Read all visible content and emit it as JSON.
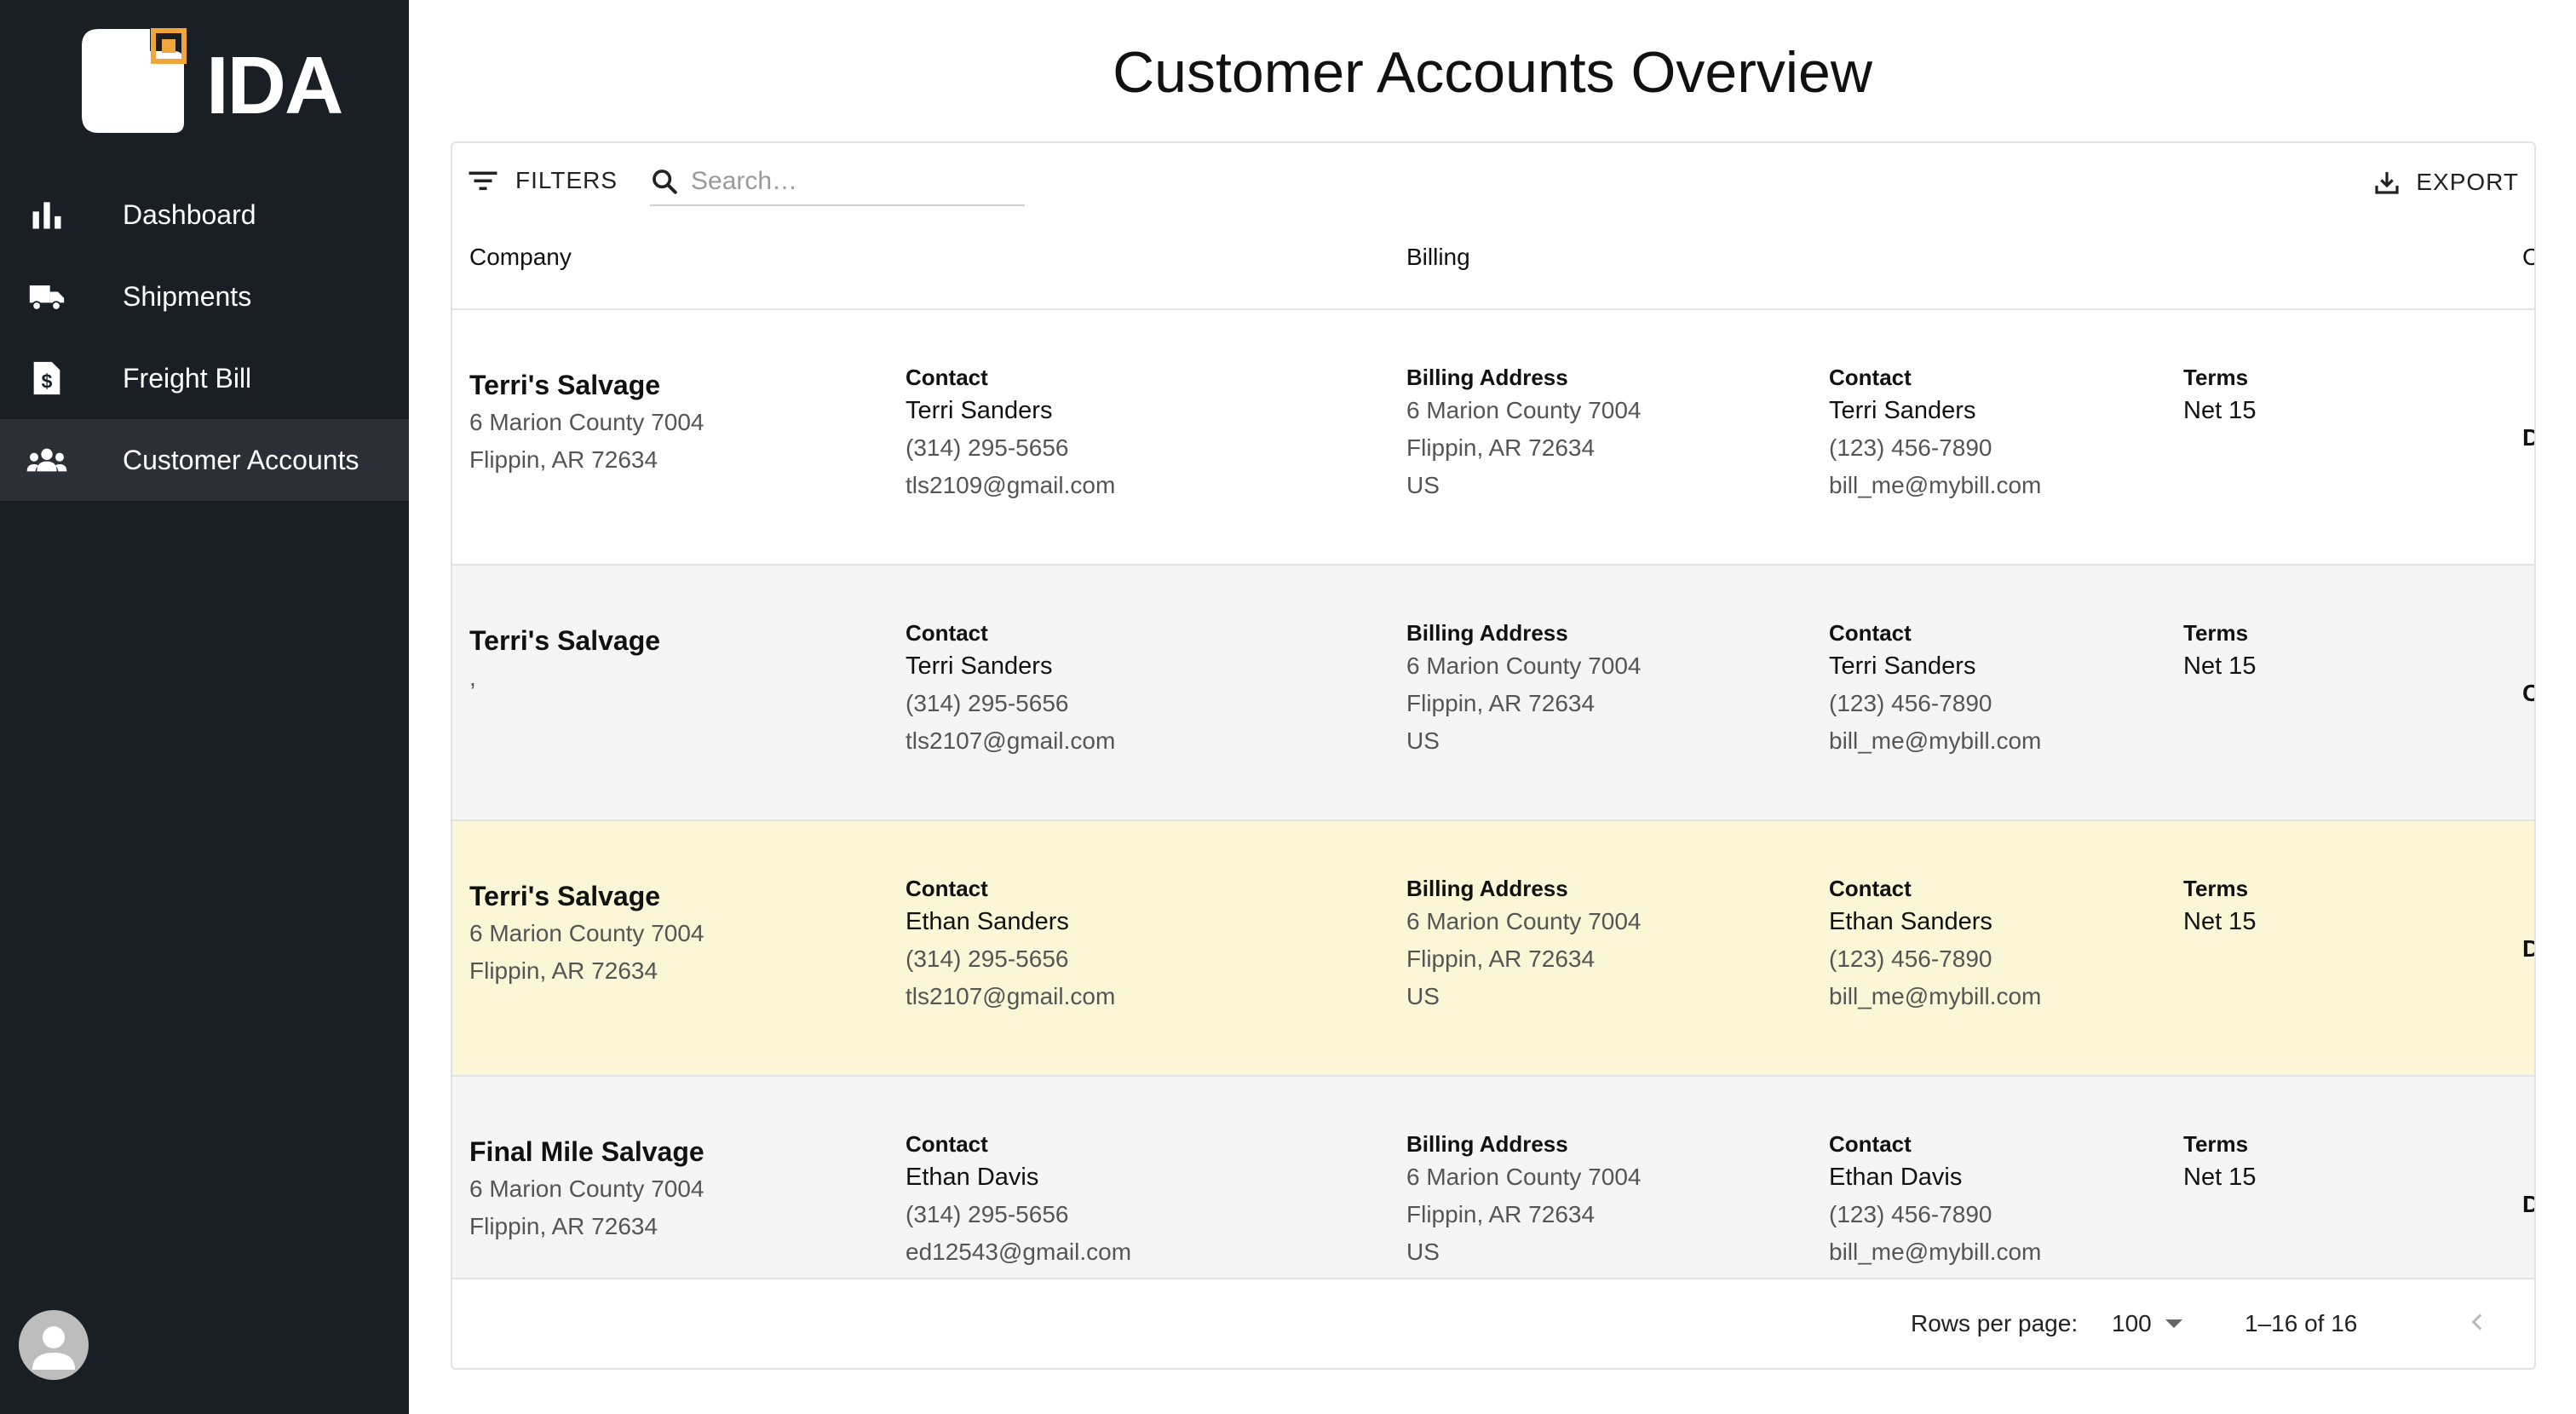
{
  "app": {
    "logo_text": "IDA"
  },
  "sidebar": {
    "items": [
      {
        "label": "Dashboard",
        "icon": "bar-chart-icon"
      },
      {
        "label": "Shipments",
        "icon": "truck-icon"
      },
      {
        "label": "Freight Bill",
        "icon": "invoice-icon"
      },
      {
        "label": "Customer Accounts",
        "icon": "people-icon",
        "active": true
      }
    ]
  },
  "page": {
    "title": "Customer Accounts Overview"
  },
  "toolbar": {
    "filters_label": "FILTERS",
    "search_placeholder": "Search…",
    "export_label": "EXPORT"
  },
  "table": {
    "headers": {
      "company": "Company",
      "billing": "Billing",
      "edge": "Co"
    },
    "field_labels": {
      "contact": "Contact",
      "billing_address": "Billing Address",
      "terms": "Terms"
    },
    "rows": [
      {
        "company": "Terri's Salvage",
        "address1": "6 Marion County 7004",
        "address2": "Flippin, AR 72634",
        "contact_name": "Terri Sanders",
        "contact_phone": "(314) 295-5656",
        "contact_email": "tls2109@gmail.com",
        "billing_line1": "6 Marion County 7004",
        "billing_line2": "Flippin, AR 72634",
        "billing_country": "US",
        "billing_contact_name": "Terri Sanders",
        "billing_contact_phone": "(123) 456-7890",
        "billing_contact_email": "bill_me@mybill.com",
        "terms": "Net 15",
        "edge": "De"
      },
      {
        "company": "Terri's Salvage",
        "address1": ",",
        "address2": "",
        "contact_name": "Terri Sanders",
        "contact_phone": "(314) 295-5656",
        "contact_email": "tls2107@gmail.com",
        "billing_line1": "6 Marion County 7004",
        "billing_line2": "Flippin, AR 72634",
        "billing_country": "US",
        "billing_contact_name": "Terri Sanders",
        "billing_contact_phone": "(123) 456-7890",
        "billing_contact_email": "bill_me@mybill.com",
        "terms": "Net 15",
        "edge": "Co"
      },
      {
        "company": "Terri's Salvage",
        "address1": "6 Marion County 7004",
        "address2": "Flippin, AR 72634",
        "contact_name": "Ethan Sanders",
        "contact_phone": "(314) 295-5656",
        "contact_email": "tls2107@gmail.com",
        "billing_line1": "6 Marion County 7004",
        "billing_line2": "Flippin, AR 72634",
        "billing_country": "US",
        "billing_contact_name": "Ethan Sanders",
        "billing_contact_phone": "(123) 456-7890",
        "billing_contact_email": "bill_me@mybill.com",
        "terms": "Net 15",
        "edge": "De"
      },
      {
        "company": "Final Mile Salvage",
        "address1": "6 Marion County 7004",
        "address2": "Flippin, AR 72634",
        "contact_name": "Ethan Davis",
        "contact_phone": "(314) 295-5656",
        "contact_email": "ed12543@gmail.com",
        "billing_line1": "6 Marion County 7004",
        "billing_line2": "Flippin, AR 72634",
        "billing_country": "US",
        "billing_contact_name": "Ethan Davis",
        "billing_contact_phone": "(123) 456-7890",
        "billing_contact_email": "bill_me@mybill.com",
        "terms": "Net 15",
        "edge": "De"
      }
    ]
  },
  "footer": {
    "rows_per_page_label": "Rows per page:",
    "rows_per_page_value": "100",
    "page_range": "1–16 of 16"
  },
  "colors": {
    "sidebar_bg": "#1a1e25",
    "active_item_bg": "#2c2f35",
    "logo_accent": "#f0a63a",
    "highlight_row_bg": "#fbf6d5",
    "alt_row_bg": "#f5f5f5"
  }
}
